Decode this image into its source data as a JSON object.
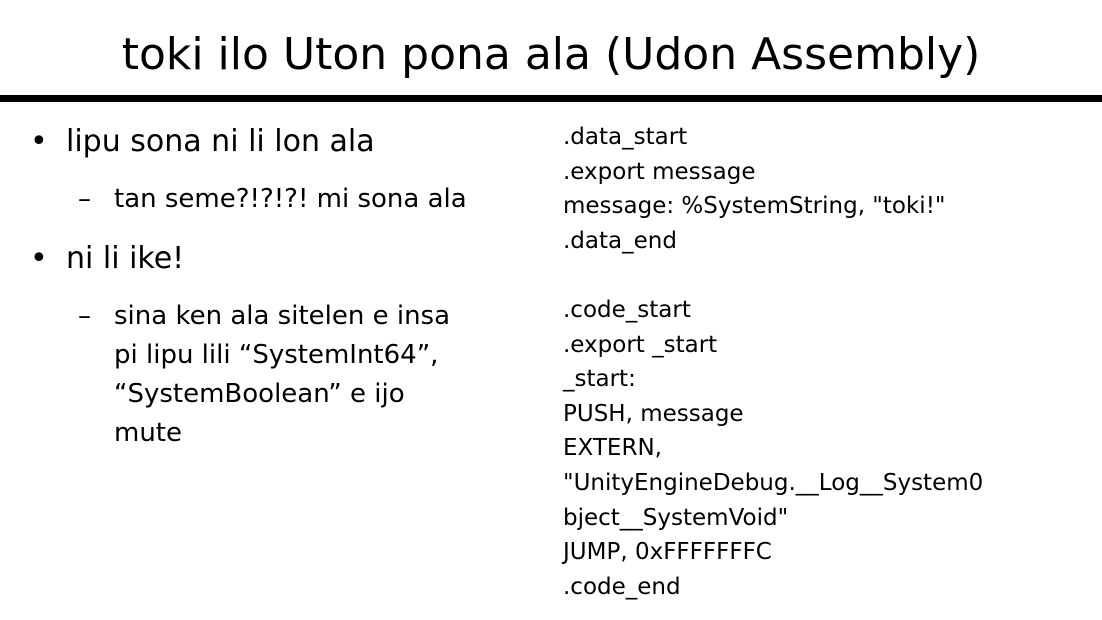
{
  "title": "toki ilo Uton pona ala (Udon Assembly)",
  "bullets": [
    {
      "text": "lipu sona ni li lon ala",
      "sub": "tan seme?!?!?! mi sona ala"
    },
    {
      "text": "ni li ike!",
      "sub": "sina ken ala sitelen e insa pi lipu lili “SystemInt64”, “SystemBoolean” e ijo mute"
    }
  ],
  "bullet_symbol": "•",
  "dash_symbol": "–",
  "code_lines": [
    ".data_start",
    ".export message",
    "message: %SystemString, \"toki!\"",
    ".data_end",
    "",
    ".code_start",
    ".export _start",
    "_start:",
    "PUSH, message",
    "EXTERN,",
    "\"UnityEngineDebug.__Log__System0",
    "bject__SystemVoid\"",
    "JUMP, 0xFFFFFFFC",
    ".code_end"
  ]
}
